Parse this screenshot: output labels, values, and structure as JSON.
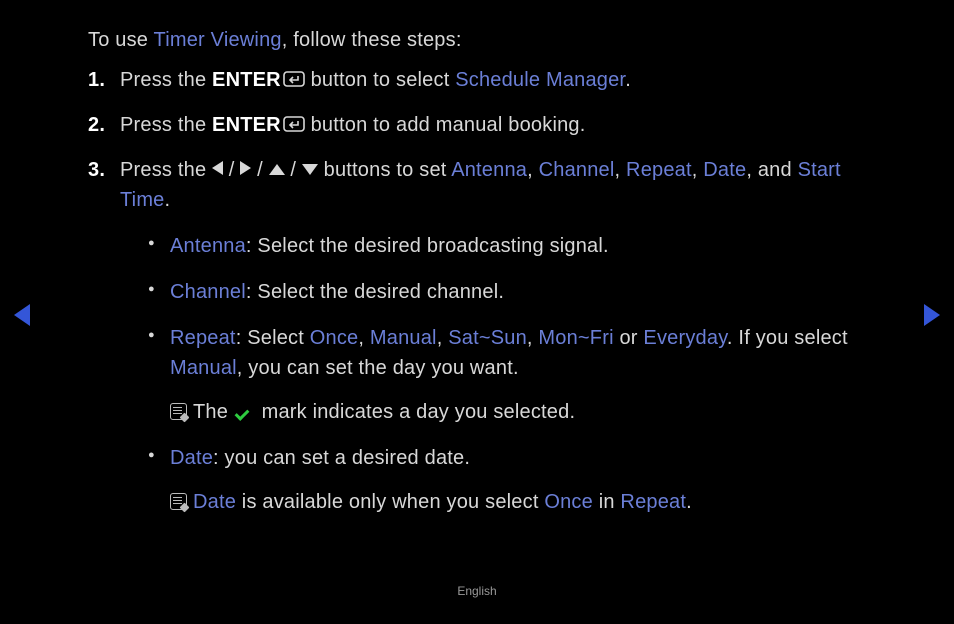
{
  "intro": {
    "prefix": "To use ",
    "highlight": "Timer Viewing",
    "suffix": ", follow these steps:"
  },
  "steps": {
    "s1": {
      "num": "1.",
      "prefix": "Press the ",
      "enter": "ENTER",
      "mid": " button to select ",
      "hl": "Schedule Manager",
      "suffix": "."
    },
    "s2": {
      "num": "2.",
      "prefix": "Press the ",
      "enter": "ENTER",
      "suffix": " button to add manual booking."
    },
    "s3": {
      "num": "3.",
      "prefix": "Press the ",
      "sep": " / ",
      "mid": " buttons to set ",
      "a": "Antenna",
      "b": "Channel",
      "c": "Repeat",
      "d": "Date",
      "comma": ", ",
      "and": ", and ",
      "e": "Start Time",
      "suffix": "."
    }
  },
  "bullets": {
    "antenna": {
      "hl": "Antenna",
      "text": ": Select the desired broadcasting signal."
    },
    "channel": {
      "hl": "Channel",
      "text": ": Select the desired channel."
    },
    "repeat": {
      "hl": "Repeat",
      "prefix": ": Select ",
      "once": "Once",
      "manual": "Manual",
      "satsun": "Sat~Sun",
      "monfri": "Mon~Fri",
      "everyday": "Everyday",
      "comma": ", ",
      "or": " or ",
      "mid": ". If you select ",
      "manual2": "Manual",
      "suffix": ", you can set the day you want.",
      "note_pre": "The ",
      "note_post": " mark indicates a day you selected."
    },
    "date": {
      "hl": "Date",
      "text": ": you can set a desired date.",
      "note_hl": "Date",
      "note_mid": " is available only when you select ",
      "note_once": "Once",
      "note_in": " in ",
      "note_repeat": "Repeat",
      "note_suffix": "."
    }
  },
  "footer": "English"
}
